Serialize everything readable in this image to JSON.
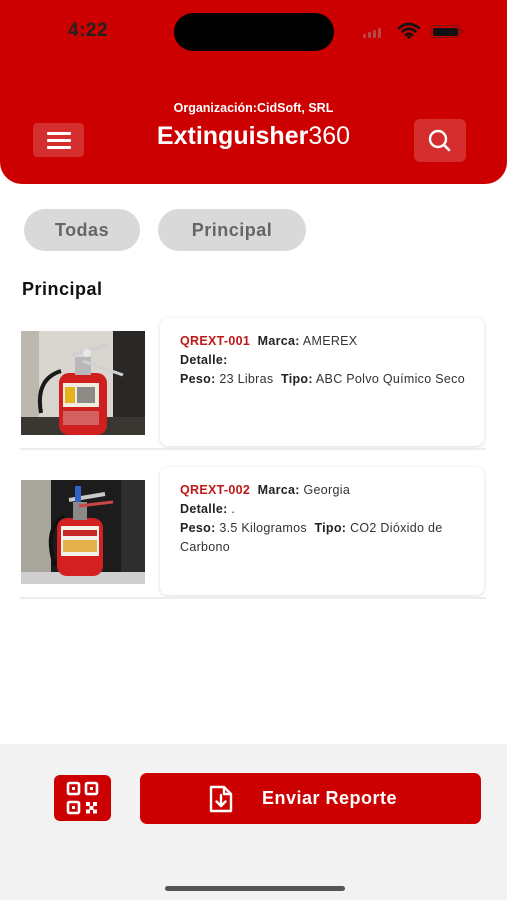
{
  "status_bar": {
    "time": "4:22"
  },
  "header": {
    "organization": "Organización:CidSoft, SRL",
    "title_bold": "Extinguisher",
    "title_light": "360",
    "icons": {
      "menu": "hamburger-menu-icon",
      "search": "search-icon"
    }
  },
  "filters": [
    {
      "label": "Todas"
    },
    {
      "label": "Principal"
    }
  ],
  "section": {
    "title": "Principal"
  },
  "items": [
    {
      "code": "QREXT-001",
      "marca_label": "Marca:",
      "marca": "AMEREX",
      "detalle_label": "Detalle:",
      "detalle": "",
      "peso_label": "Peso:",
      "peso": "23 Libras",
      "tipo_label": "Tipo:",
      "tipo": "ABC Polvo Químico Seco",
      "image": "fire-extinguisher-photo"
    },
    {
      "code": "QREXT-002",
      "marca_label": "Marca:",
      "marca": "Georgia",
      "detalle_label": "Detalle:",
      "detalle": ".",
      "peso_label": "Peso:",
      "peso": "3.5 Kilogramos",
      "tipo_label": "Tipo:",
      "tipo": "CO2 Dióxido de Carbono",
      "image": "fire-extinguisher-photo"
    }
  ],
  "footer": {
    "qr_icon": "qr-code-icon",
    "send_icon": "download-document-icon",
    "send_label": "Enviar Reporte"
  },
  "colors": {
    "brand_red": "#cc0000",
    "code_red": "#c01818",
    "chip_gray": "#d9d9d9",
    "footer_bg": "#f2f2f2"
  }
}
